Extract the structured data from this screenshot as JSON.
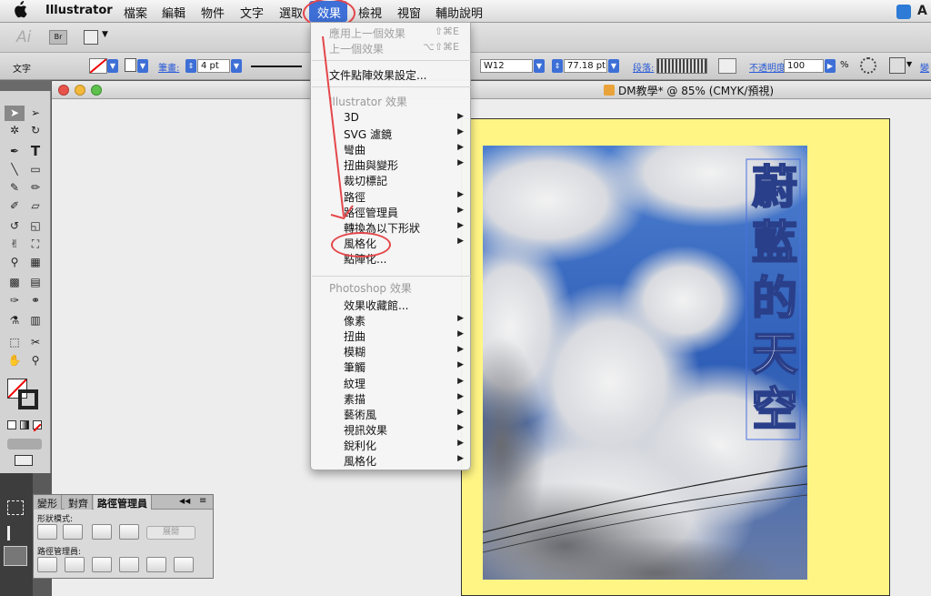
{
  "menubar": {
    "app_name": "Illustrator",
    "items": [
      "檔案",
      "編輯",
      "物件",
      "文字",
      "選取",
      "效果",
      "檢視",
      "視窗",
      "輔助說明"
    ],
    "active": "效果"
  },
  "appbar": {
    "logo": "Ai",
    "bridge": "Br"
  },
  "control": {
    "label": "文字",
    "stroke_label": "筆畫:",
    "stroke_value": "4 pt",
    "font_name": "W12",
    "font_size": "77.18 pt",
    "paragraph_label": "段落:",
    "opacity_label": "不透明度:",
    "opacity_value": "100",
    "percent": "%",
    "trail": "變"
  },
  "document": {
    "title": "DM教學* @ 85% (CMYK/預視)"
  },
  "artwork": {
    "vertical_text": "蔚藍的天空"
  },
  "pathfinder": {
    "tabs": [
      "變形",
      "對齊",
      "路徑管理員"
    ],
    "shape_modes_label": "形狀模式:",
    "expand_label": "展開",
    "pathfinder_label": "路徑管理員:"
  },
  "effect_menu": {
    "apply_last": {
      "label": "應用上一個效果",
      "shortcut": "⇧⌘E"
    },
    "last": {
      "label": "上一個效果",
      "shortcut": "⌥⇧⌘E"
    },
    "doc_raster": "文件點陣效果設定...",
    "illustrator_header": "Illustrator 效果",
    "illustrator_items": [
      {
        "label": "3D",
        "submenu": true
      },
      {
        "label": "SVG 濾鏡",
        "submenu": true
      },
      {
        "label": "彎曲",
        "submenu": true
      },
      {
        "label": "扭曲與變形",
        "submenu": true
      },
      {
        "label": "裁切標記",
        "submenu": false
      },
      {
        "label": "路徑",
        "submenu": true
      },
      {
        "label": "路徑管理員",
        "submenu": true
      },
      {
        "label": "轉換為以下形狀",
        "submenu": true
      },
      {
        "label": "風格化",
        "submenu": true
      },
      {
        "label": "點陣化...",
        "submenu": false
      }
    ],
    "photoshop_header": "Photoshop 效果",
    "photoshop_items": [
      {
        "label": "效果收藏館...",
        "submenu": false
      },
      {
        "label": "像素",
        "submenu": true
      },
      {
        "label": "扭曲",
        "submenu": true
      },
      {
        "label": "模糊",
        "submenu": true
      },
      {
        "label": "筆觸",
        "submenu": true
      },
      {
        "label": "紋理",
        "submenu": true
      },
      {
        "label": "素描",
        "submenu": true
      },
      {
        "label": "藝術風",
        "submenu": true
      },
      {
        "label": "視訊效果",
        "submenu": true
      },
      {
        "label": "銳利化",
        "submenu": true
      },
      {
        "label": "風格化",
        "submenu": true
      }
    ]
  },
  "colors": {
    "menu_highlight": "#3d6fd6",
    "annotation_red": "#e4474b",
    "artboard": "#fff585"
  }
}
